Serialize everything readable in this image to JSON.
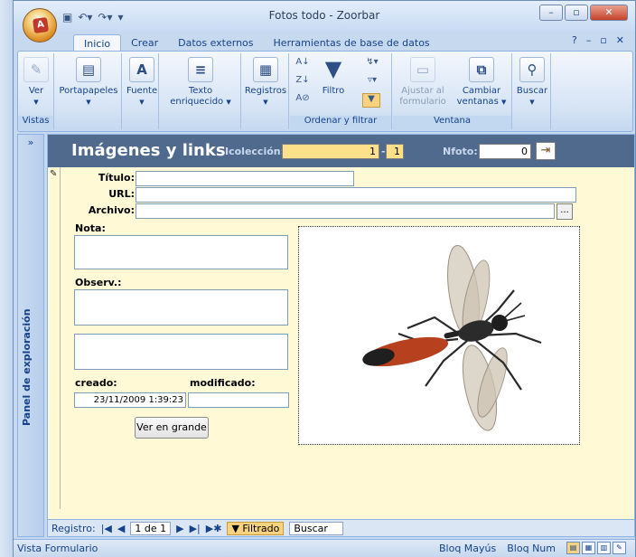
{
  "window": {
    "title": "Fotos todo - Zoorbar"
  },
  "tabs": [
    "Inicio",
    "Crear",
    "Datos externos",
    "Herramientas de base de datos"
  ],
  "ribbon": {
    "ver": "Ver",
    "vistas": "Vistas",
    "portapapeles": "Portapapeles",
    "fuente": "Fuente",
    "texto_line1": "Texto",
    "texto_line2": "enriquecido",
    "registros": "Registros",
    "filtro": "Filtro",
    "ordenar_filtrar": "Ordenar y filtrar",
    "ajustar_line1": "Ajustar al",
    "ajustar_line2": "formulario",
    "cambiar_line1": "Cambiar",
    "cambiar_line2": "ventanas",
    "ventana": "Ventana",
    "buscar": "Buscar"
  },
  "nav_pane": {
    "label": "Panel de exploración",
    "collapse": "»"
  },
  "form": {
    "title": "Imágenes y links",
    "coleccion_label": "Icolección:",
    "coleccion_value": "1",
    "coleccion_value2": "1",
    "nfoto_label": "Nfoto:",
    "nfoto_value": "0",
    "titulo_label": "Título:",
    "url_label": "URL:",
    "archivo_label": "Archivo:",
    "archivo_button": "...",
    "nota_label": "Nota:",
    "observ_label": "Observ.:",
    "creado_label": "creado:",
    "creado_value": "23/11/2009 1:39:23",
    "modificado_label": "modificado:",
    "ver_grande": "Ver en grande"
  },
  "record_nav": {
    "registro_label": "Registro:",
    "position": "1 de 1",
    "filtrado": "Filtrado",
    "buscar": "Buscar"
  },
  "status": {
    "left": "Vista Formulario",
    "bloq_mayus": "Bloq Mayús",
    "bloq_num": "Bloq Num"
  },
  "colors": {
    "header": "#506a8e",
    "form_bg": "#fffad5",
    "accent": "#ffe08a"
  },
  "icons": [
    "office-button-icon",
    "save-icon",
    "undo-icon",
    "redo-icon",
    "view-icon",
    "paste-icon",
    "font-icon",
    "paragraph-icon",
    "records-icon",
    "sort-asc-icon",
    "sort-desc-icon",
    "clear-sort-icon",
    "filter-icon",
    "advanced-filter-icon",
    "toggle-filter-icon",
    "fit-form-icon",
    "switch-windows-icon",
    "find-icon",
    "open-form-icon"
  ]
}
